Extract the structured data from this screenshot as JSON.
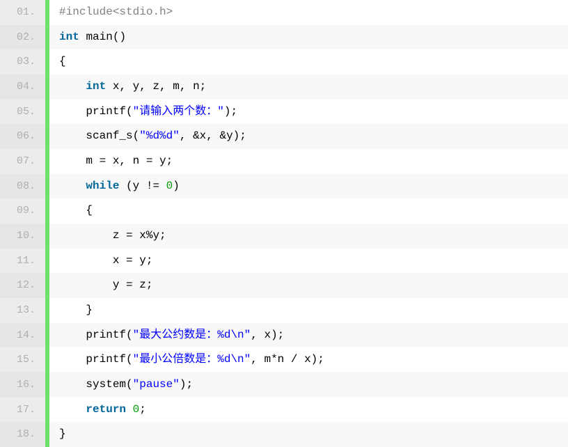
{
  "lines": [
    {
      "num": "01.",
      "tokens": [
        {
          "cls": "tok-preproc",
          "text": "#include<stdio.h>"
        }
      ]
    },
    {
      "num": "02.",
      "tokens": [
        {
          "cls": "tok-keyword",
          "text": "int"
        },
        {
          "cls": "tok-punct",
          "text": " "
        },
        {
          "cls": "tok-func",
          "text": "main"
        },
        {
          "cls": "tok-punct",
          "text": "()"
        }
      ]
    },
    {
      "num": "03.",
      "tokens": [
        {
          "cls": "tok-punct",
          "text": "{"
        }
      ]
    },
    {
      "num": "04.",
      "indent": 1,
      "tokens": [
        {
          "cls": "tok-keyword",
          "text": "int"
        },
        {
          "cls": "tok-punct",
          "text": " "
        },
        {
          "cls": "tok-ident",
          "text": "x, y, z, m, n;"
        }
      ]
    },
    {
      "num": "05.",
      "indent": 1,
      "tokens": [
        {
          "cls": "tok-func",
          "text": "printf"
        },
        {
          "cls": "tok-punct",
          "text": "("
        },
        {
          "cls": "tok-string",
          "text": "\"请输入两个数：\""
        },
        {
          "cls": "tok-punct",
          "text": ");"
        }
      ]
    },
    {
      "num": "06.",
      "indent": 1,
      "tokens": [
        {
          "cls": "tok-func",
          "text": "scanf_s"
        },
        {
          "cls": "tok-punct",
          "text": "("
        },
        {
          "cls": "tok-string",
          "text": "\"%d%d\""
        },
        {
          "cls": "tok-punct",
          "text": ", &x, &y);"
        }
      ]
    },
    {
      "num": "07.",
      "indent": 1,
      "tokens": [
        {
          "cls": "tok-ident",
          "text": "m = x, n = y;"
        }
      ]
    },
    {
      "num": "08.",
      "indent": 1,
      "tokens": [
        {
          "cls": "tok-keyword",
          "text": "while"
        },
        {
          "cls": "tok-punct",
          "text": " (y != "
        },
        {
          "cls": "tok-number",
          "text": "0"
        },
        {
          "cls": "tok-punct",
          "text": ")"
        }
      ]
    },
    {
      "num": "09.",
      "indent": 1,
      "tokens": [
        {
          "cls": "tok-punct",
          "text": "{"
        }
      ]
    },
    {
      "num": "10.",
      "indent": 2,
      "tokens": [
        {
          "cls": "tok-ident",
          "text": "z = x%y;"
        }
      ]
    },
    {
      "num": "11.",
      "indent": 2,
      "tokens": [
        {
          "cls": "tok-ident",
          "text": "x = y;"
        }
      ]
    },
    {
      "num": "12.",
      "indent": 2,
      "tokens": [
        {
          "cls": "tok-ident",
          "text": "y = z;"
        }
      ]
    },
    {
      "num": "13.",
      "indent": 1,
      "tokens": [
        {
          "cls": "tok-punct",
          "text": "}"
        }
      ]
    },
    {
      "num": "14.",
      "indent": 1,
      "tokens": [
        {
          "cls": "tok-func",
          "text": "printf"
        },
        {
          "cls": "tok-punct",
          "text": "("
        },
        {
          "cls": "tok-string",
          "text": "\"最大公约数是：%d\\n\""
        },
        {
          "cls": "tok-punct",
          "text": ", x);"
        }
      ]
    },
    {
      "num": "15.",
      "indent": 1,
      "tokens": [
        {
          "cls": "tok-func",
          "text": "printf"
        },
        {
          "cls": "tok-punct",
          "text": "("
        },
        {
          "cls": "tok-string",
          "text": "\"最小公倍数是：%d\\n\""
        },
        {
          "cls": "tok-punct",
          "text": ", m*n / x);"
        }
      ]
    },
    {
      "num": "16.",
      "indent": 1,
      "tokens": [
        {
          "cls": "tok-func",
          "text": "system"
        },
        {
          "cls": "tok-punct",
          "text": "("
        },
        {
          "cls": "tok-string",
          "text": "\"pause\""
        },
        {
          "cls": "tok-punct",
          "text": ");"
        }
      ]
    },
    {
      "num": "17.",
      "indent": 1,
      "tokens": [
        {
          "cls": "tok-keyword",
          "text": "return"
        },
        {
          "cls": "tok-punct",
          "text": " "
        },
        {
          "cls": "tok-number",
          "text": "0"
        },
        {
          "cls": "tok-punct",
          "text": ";"
        }
      ]
    },
    {
      "num": "18.",
      "tokens": [
        {
          "cls": "tok-punct",
          "text": "}"
        }
      ]
    }
  ]
}
